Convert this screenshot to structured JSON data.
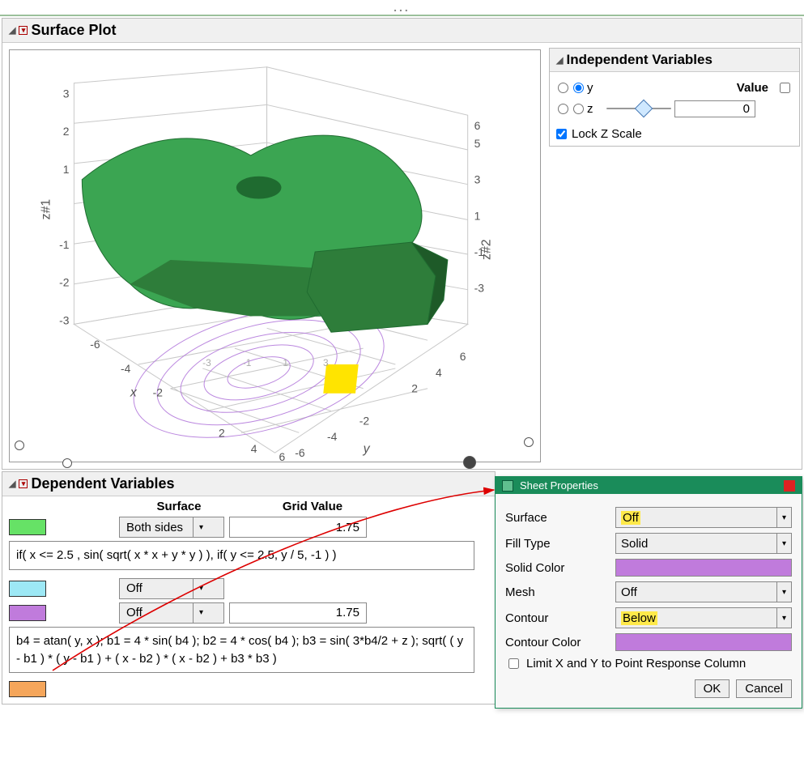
{
  "title_bar_dots": "...",
  "surface_section": "Surface Plot",
  "chart_data": {
    "type": "surface3d",
    "axes": {
      "x": {
        "label": "x",
        "range": [
          -6,
          6
        ],
        "ticks": [
          -6,
          -4,
          -2,
          2,
          4,
          6
        ]
      },
      "y": {
        "label": "y",
        "range": [
          -6,
          6
        ],
        "ticks": [
          -6,
          -4,
          -2,
          2,
          4,
          6
        ]
      },
      "z1": {
        "label": "z#1",
        "range": [
          -3,
          3
        ],
        "ticks": [
          -3,
          -2,
          -1,
          1,
          2,
          3
        ]
      },
      "z2": {
        "label": "z#2",
        "range": [
          -3,
          3
        ],
        "ticks": [
          -3,
          -1,
          1,
          3,
          5,
          6
        ]
      }
    },
    "surfaces": [
      {
        "color": "#2e9b3f",
        "formula": "if( x <= 2.5 , sin( sqrt( x * x + y * y ) ), if( y <= 2.5, y / 5, -1 ) )",
        "sides": "Both sides"
      }
    ],
    "contour_below_color": "#c07bdc",
    "highlight_marker_color": "#ffe400"
  },
  "indep": {
    "header": "Independent Variables",
    "value_header": "Value",
    "vars": [
      {
        "name": "y",
        "r1": false,
        "r2": true,
        "value": ""
      },
      {
        "name": "z",
        "r1": false,
        "r2": false,
        "value": "0"
      }
    ],
    "lock": "Lock Z Scale"
  },
  "dep": {
    "header": "Dependent Variables",
    "col_surface": "Surface",
    "col_grid": "Grid Value",
    "rows": [
      {
        "swatch": "sw-green",
        "dd": "Both sides",
        "grid": "1.75"
      },
      {
        "swatch": "sw-cyan",
        "dd": "Off",
        "grid": null
      },
      {
        "swatch": "sw-violet",
        "dd": "Off",
        "grid": "1.75"
      },
      {
        "swatch": "sw-orange",
        "dd": null,
        "grid": null
      }
    ],
    "formula1": "if( x <= 2.5 , sin( sqrt( x * x + y * y ) ), if( y <= 2.5, y / 5, -1 ) )",
    "formula2": "b4 = atan( y, x ); b1 = 4 * sin( b4 ); b2 = 4 * cos( b4 ); b3 = sin( 3*b4/2 + z ); sqrt( ( y - b1 ) * ( y - b1 ) + ( x - b2 ) * ( x - b2 ) + b3 * b3 )"
  },
  "dialog": {
    "title": "Sheet Properties",
    "props": {
      "surface_label": "Surface",
      "surface_val": "Off",
      "fill_label": "Fill Type",
      "fill_val": "Solid",
      "solid_color_label": "Solid Color",
      "mesh_label": "Mesh",
      "mesh_val": "Off",
      "contour_label": "Contour",
      "contour_val": "Below",
      "contour_color_label": "Contour Color",
      "limit_label": "Limit X and Y to Point Response Column"
    },
    "ok": "OK",
    "cancel": "Cancel"
  }
}
